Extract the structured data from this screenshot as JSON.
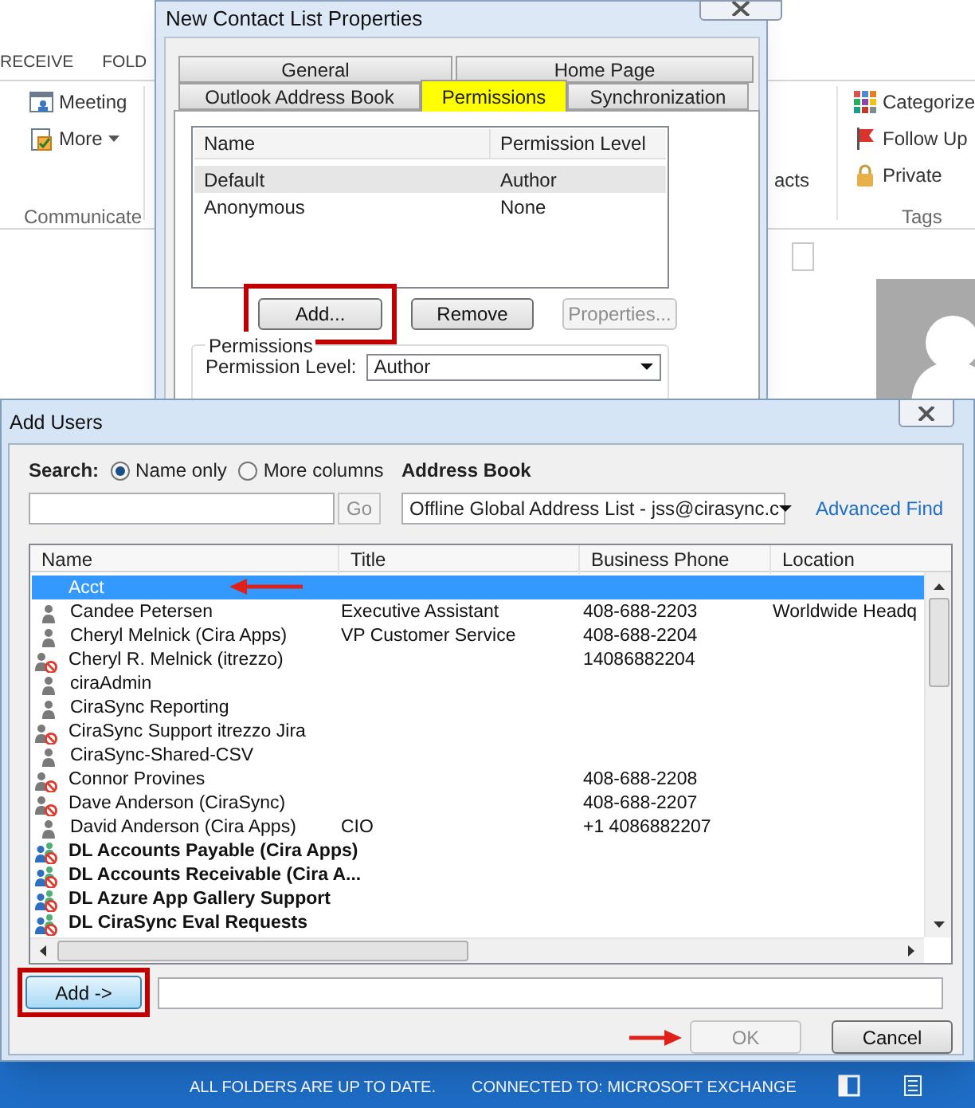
{
  "background_app": {
    "ribbon_tabs": [
      "RECEIVE",
      "FOLD"
    ],
    "communicate_group": {
      "label": "Communicate",
      "items": [
        {
          "label": "Meeting",
          "kind": "button"
        },
        {
          "label": "More",
          "kind": "dropdown"
        }
      ]
    },
    "partial_label": "acts",
    "tags_group": {
      "label": "Tags",
      "items": [
        {
          "label": "Categorize"
        },
        {
          "label": "Follow Up"
        },
        {
          "label": "Private"
        }
      ]
    },
    "status_bar": [
      "ALL FOLDERS ARE UP TO DATE.",
      "CONNECTED TO: MICROSOFT EXCHANGE"
    ]
  },
  "properties_dialog": {
    "title": "New Contact List Properties",
    "tab_rows": [
      [
        {
          "label": "General",
          "selected": false
        },
        {
          "label": "Home Page",
          "selected": false
        }
      ],
      [
        {
          "label": "Outlook Address Book",
          "selected": false
        },
        {
          "label": "Permissions",
          "selected": true
        },
        {
          "label": "Synchronization",
          "selected": false
        }
      ]
    ],
    "permissions_list": {
      "columns": [
        "Name",
        "Permission Level"
      ],
      "rows": [
        {
          "name": "Default",
          "permission_level": "Author",
          "selected": true
        },
        {
          "name": "Anonymous",
          "permission_level": "None",
          "selected": false
        }
      ]
    },
    "buttons": [
      {
        "label": "Add...",
        "disabled": false,
        "highlighted": true
      },
      {
        "label": "Remove",
        "disabled": false,
        "highlighted": false
      },
      {
        "label": "Properties...",
        "disabled": true,
        "highlighted": false
      }
    ],
    "permissions_group": {
      "label": "Permissions",
      "permission_level_label": "Permission Level:",
      "permission_level_value": "Author"
    }
  },
  "add_users_dialog": {
    "title": "Add Users",
    "search_label": "Search:",
    "search_options": [
      {
        "label": "Name only",
        "selected": true
      },
      {
        "label": "More columns",
        "selected": false
      }
    ],
    "go_button": {
      "label": "Go",
      "disabled": true
    },
    "address_book_label": "Address Book",
    "address_book_value": "Offline Global Address List - jss@cirasync.c",
    "advanced_find": "Advanced Find",
    "columns": [
      "Name",
      "Title",
      "Business Phone",
      "Location"
    ],
    "rows": [
      {
        "kind": "plain",
        "name": "Acct",
        "selected": true,
        "pointed": true
      },
      {
        "kind": "user",
        "name": "Candee Petersen",
        "title": "Executive Assistant",
        "phone": "408-688-2203",
        "location": "Worldwide Headq",
        "selected": false,
        "pointed": false
      },
      {
        "kind": "user",
        "name": "Cheryl Melnick (Cira Apps)",
        "title": "VP Customer Service",
        "phone": "408-688-2204",
        "selected": false,
        "pointed": false
      },
      {
        "kind": "user_blocked",
        "name": "Cheryl R. Melnick (itrezzo)",
        "phone": "14086882204",
        "selected": false,
        "pointed": false
      },
      {
        "kind": "user",
        "name": "ciraAdmin",
        "selected": false,
        "pointed": false
      },
      {
        "kind": "user",
        "name": "CiraSync Reporting",
        "selected": false,
        "pointed": false
      },
      {
        "kind": "user_blocked",
        "name": "CiraSync Support itrezzo Jira",
        "selected": false,
        "pointed": false
      },
      {
        "kind": "user",
        "name": "CiraSync-Shared-CSV",
        "selected": false,
        "pointed": false
      },
      {
        "kind": "user_blocked",
        "name": "Connor Provines",
        "phone": "408-688-2208",
        "selected": false,
        "pointed": false
      },
      {
        "kind": "user_blocked",
        "name": "Dave Anderson (CiraSync)",
        "phone": "408-688-2207",
        "selected": false,
        "pointed": false
      },
      {
        "kind": "user",
        "name": "David Anderson (Cira Apps)",
        "title": "CIO",
        "phone": "+1 4086882207",
        "selected": false,
        "pointed": false
      },
      {
        "kind": "group_blocked",
        "name": "DL Accounts Payable (Cira Apps)",
        "selected": false,
        "pointed": false
      },
      {
        "kind": "group_blocked",
        "name": "DL Accounts Receivable (Cira A...",
        "selected": false,
        "pointed": false
      },
      {
        "kind": "group_blocked",
        "name": "DL Azure App Gallery Support",
        "selected": false,
        "pointed": false
      },
      {
        "kind": "group_blocked",
        "name": "DL CiraSync Eval Requests",
        "selected": false,
        "pointed": false
      }
    ],
    "add_button": {
      "label": "Add ->",
      "highlighted": true
    },
    "ok_button": {
      "label": "OK",
      "disabled": true,
      "pointed": true
    },
    "cancel_button": {
      "label": "Cancel",
      "disabled": false
    }
  }
}
